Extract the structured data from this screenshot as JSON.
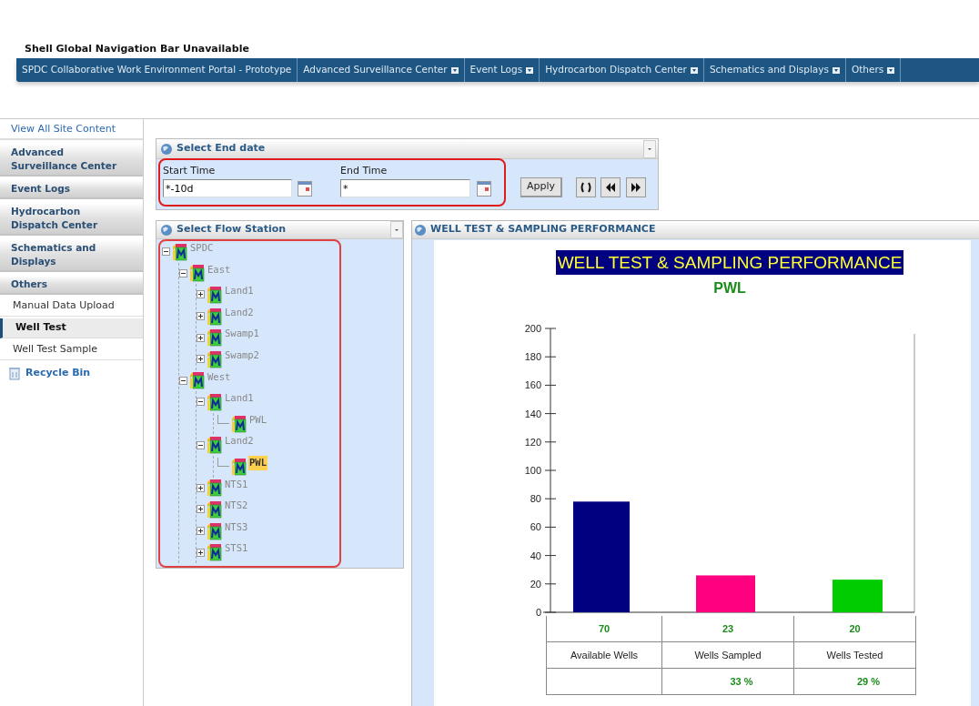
{
  "header": {
    "title": "Shell Global Navigation Bar Unavailable"
  },
  "nav_bar": [
    {
      "label": "SPDC Collaborative Work Environment Portal - Prototype",
      "dropdown": false
    },
    {
      "label": "Advanced Surveillance Center",
      "dropdown": true
    },
    {
      "label": "Event Logs",
      "dropdown": true
    },
    {
      "label": "Hydrocarbon Dispatch Center",
      "dropdown": true
    },
    {
      "label": "Schematics and Displays",
      "dropdown": true
    },
    {
      "label": "Others",
      "dropdown": true
    }
  ],
  "sidebar": {
    "link": "View All Site Content",
    "items": [
      {
        "label": "Advanced Surveillance Center",
        "kind": "heading"
      },
      {
        "label": "Event Logs",
        "kind": "heading"
      },
      {
        "label": "Hydrocarbon Dispatch Center",
        "kind": "heading"
      },
      {
        "label": "Schematics and Displays",
        "kind": "heading"
      },
      {
        "label": "Others",
        "kind": "heading"
      },
      {
        "label": "Manual Data Upload",
        "kind": "page",
        "selected": false
      },
      {
        "label": "Well Test",
        "kind": "page",
        "selected": true
      },
      {
        "label": "Well Test Sample",
        "kind": "page",
        "selected": false
      }
    ],
    "recycle_bin": "Recycle Bin"
  },
  "date_panel": {
    "title": "Select End date",
    "start_label": "Start Time",
    "start_value": "*-10d",
    "end_label": "End Time",
    "end_value": "*",
    "apply": "Apply"
  },
  "flow_station": {
    "title": "Select Flow Station",
    "tree": [
      {
        "label": "SPDC",
        "expanded": true,
        "selected": false,
        "children": [
          {
            "label": "East",
            "expanded": true,
            "selected": false,
            "children": [
              {
                "label": "Land1",
                "expanded": false,
                "selected": false
              },
              {
                "label": "Land2",
                "expanded": false,
                "selected": false
              },
              {
                "label": "Swamp1",
                "expanded": false,
                "selected": false
              },
              {
                "label": "Swamp2",
                "expanded": false,
                "selected": false
              }
            ]
          },
          {
            "label": "West",
            "expanded": true,
            "selected": false,
            "children": [
              {
                "label": "Land1",
                "expanded": true,
                "selected": false,
                "children": [
                  {
                    "label": "PWL",
                    "selected": false
                  }
                ]
              },
              {
                "label": "Land2",
                "expanded": true,
                "selected": false,
                "children": [
                  {
                    "label": "PWL",
                    "selected": true
                  }
                ]
              },
              {
                "label": "NTS1",
                "expanded": false,
                "selected": false
              },
              {
                "label": "NTS2",
                "expanded": false,
                "selected": false
              },
              {
                "label": "NTS3",
                "expanded": false,
                "selected": false
              },
              {
                "label": "STS1",
                "expanded": false,
                "selected": false
              }
            ]
          }
        ]
      }
    ]
  },
  "performance": {
    "title": "WELL TEST & SAMPLING PERFORMANCE",
    "chart_subtitle": "PWL",
    "chart_data": {
      "type": "bar",
      "title": "WELL TEST & SAMPLING PERFORMANCE",
      "categories": [
        "Available Wells",
        "Wells Sampled",
        "Wells Tested"
      ],
      "series": [
        {
          "values": [
            78,
            26,
            23
          ]
        }
      ],
      "ylim": [
        0,
        200
      ],
      "yticks": [
        0,
        20,
        40,
        60,
        80,
        100,
        120,
        140,
        160,
        180,
        200
      ]
    },
    "table": [
      {
        "value": "70"
      },
      {
        "value": "23",
        "percent": "33 %"
      },
      {
        "value": "20",
        "percent": "29 %"
      }
    ]
  }
}
